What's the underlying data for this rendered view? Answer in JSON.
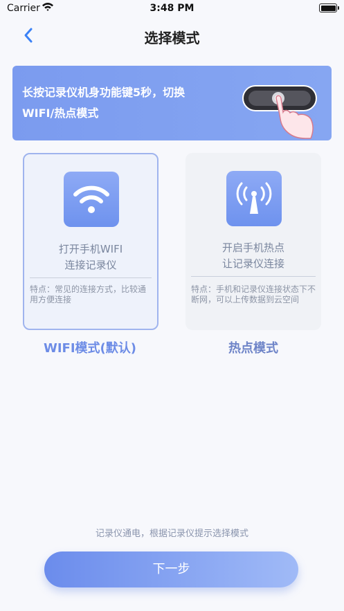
{
  "status_bar": {
    "carrier": "Carrier",
    "time": "3:48 PM"
  },
  "nav": {
    "title": "选择模式"
  },
  "banner": {
    "text_line1": "长按记录仪机身功能键5秒，切换",
    "text_line2": "WIFI/热点模式"
  },
  "modes": [
    {
      "label": "WIFI模式(默认)",
      "main_line1": "打开手机WIFI",
      "main_line2": "连接记录仪",
      "note": "特点：常见的连接方式，比较通用方便连接",
      "selected": true,
      "icon": "wifi-icon"
    },
    {
      "label": "热点模式",
      "main_line1": "开启手机热点",
      "main_line2": "让记录仪连接",
      "note": "特点：手机和记录仪连接状态下不断网，可以上传数据到云空间",
      "selected": false,
      "icon": "hotspot-antenna-icon"
    }
  ],
  "hint": "记录仪通电，根据记录仪提示选择模式",
  "next_button": "下一步",
  "colors": {
    "accent": "#6d8ce6",
    "banner": "#7b9bef",
    "button_start": "#6b8cec",
    "button_end": "#a0baf7"
  }
}
